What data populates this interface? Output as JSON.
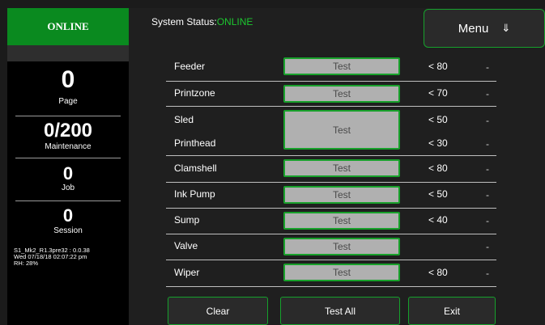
{
  "sidebar": {
    "online_label": "ONLINE",
    "counters": [
      {
        "value": "0",
        "label": "Page"
      },
      {
        "value": "0/200",
        "label": "Maintenance"
      },
      {
        "value": "0",
        "label": "Job"
      },
      {
        "value": "0",
        "label": "Session"
      }
    ],
    "info": {
      "version": "S1_Mk2_R1.3pre32 : 0.0.38",
      "datetime": "Wed 07/18/18 02:07:22 pm",
      "humidity": "RH: 28%"
    }
  },
  "header": {
    "status_label": "System Status:",
    "status_value": "ONLINE",
    "menu_label": "Menu",
    "menu_icon": "⇓"
  },
  "components": [
    {
      "name": "Feeder",
      "test": "Test",
      "threshold": "< 80",
      "reading": "-"
    },
    {
      "name": "Printzone",
      "test": "Test",
      "threshold": "< 70",
      "reading": "-"
    },
    {
      "name": "Sled",
      "test": "Test",
      "threshold": "< 50",
      "reading": "-"
    },
    {
      "name": "Printhead",
      "threshold": "< 30",
      "reading": "-"
    },
    {
      "name": "Clamshell",
      "test": "Test",
      "threshold": "< 80",
      "reading": "-"
    },
    {
      "name": "Ink Pump",
      "test": "Test",
      "threshold": "< 50",
      "reading": "-"
    },
    {
      "name": "Sump",
      "test": "Test",
      "threshold": "< 40",
      "reading": "-"
    },
    {
      "name": "Valve",
      "test": "Test",
      "threshold": "",
      "reading": "-"
    },
    {
      "name": "Wiper",
      "test": "Test",
      "threshold": "< 80",
      "reading": "-"
    }
  ],
  "footer": {
    "clear_label": "Clear",
    "test_all_label": "Test All",
    "exit_label": "Exit"
  },
  "colors": {
    "accent_green": "#0a8a1f",
    "button_border_green": "#16a12c",
    "status_green": "#1cc72f",
    "test_button_gray": "#b0b0b0"
  }
}
